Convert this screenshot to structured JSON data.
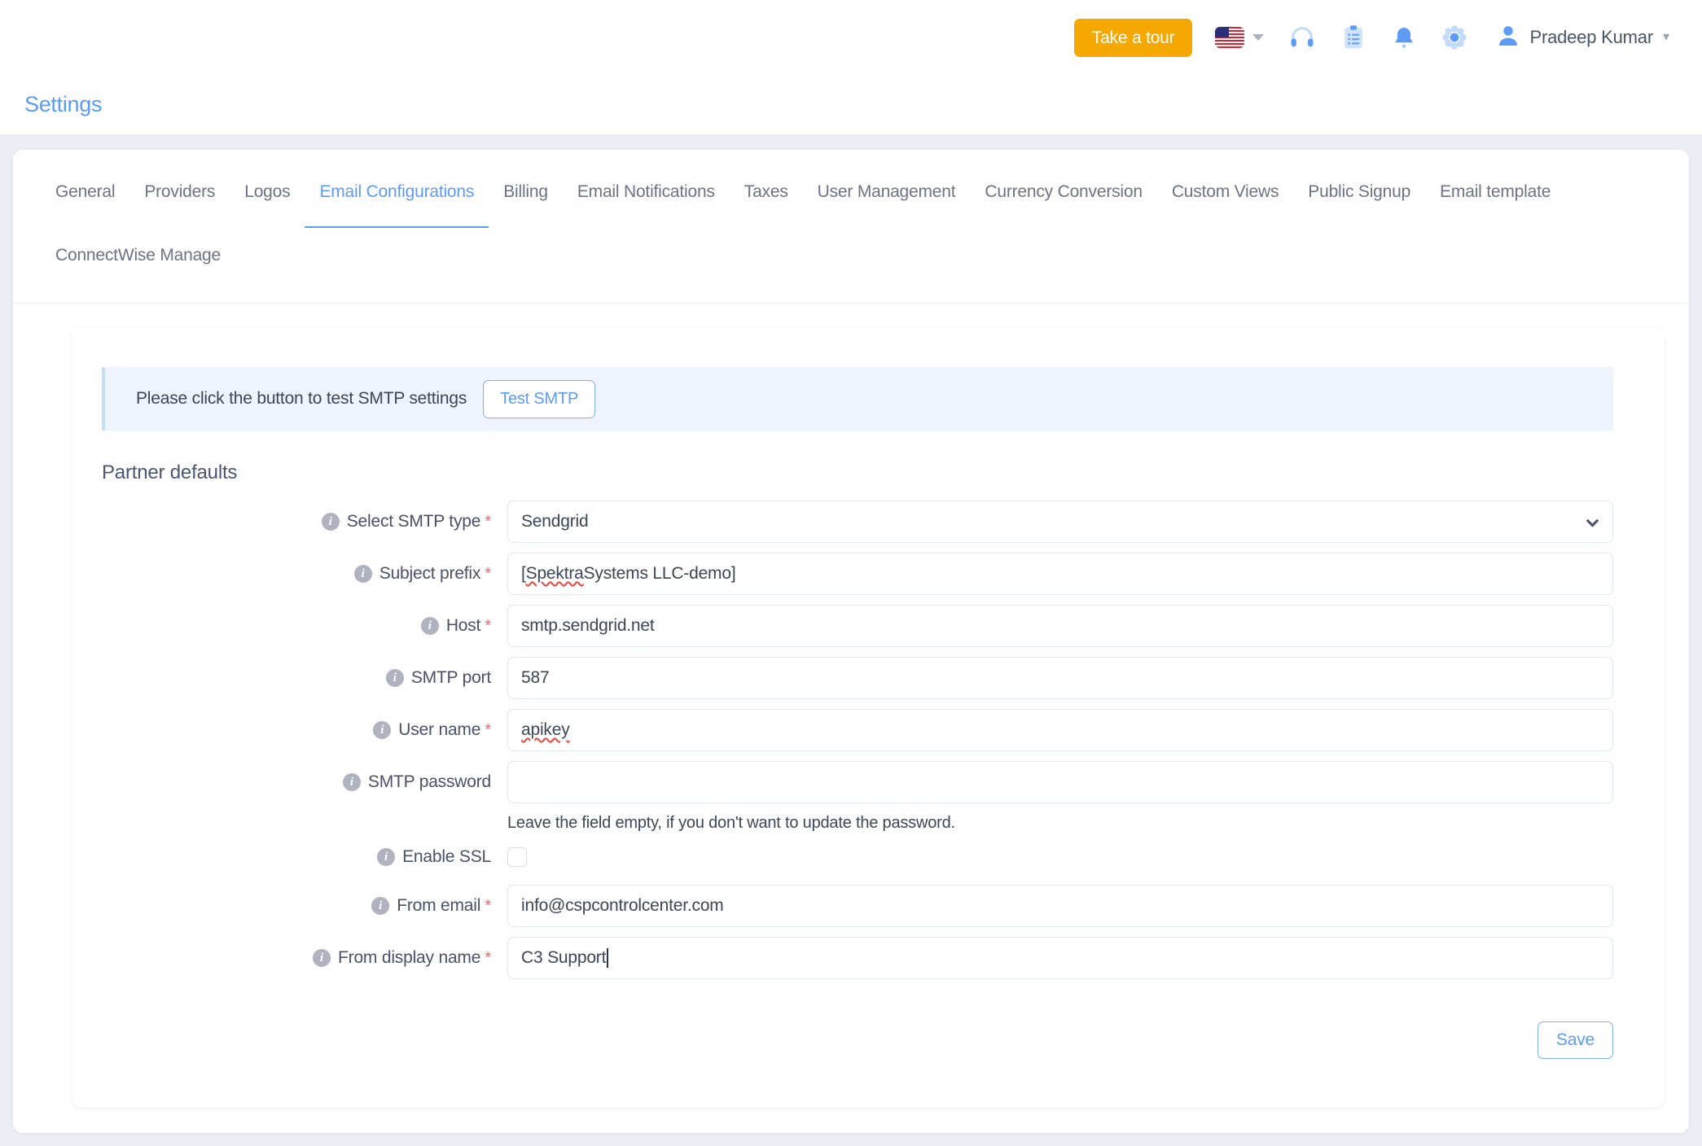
{
  "topbar": {
    "take_tour_label": "Take a tour",
    "flag_icon": "us-flag-icon",
    "language_caret": "chevron-down-icon",
    "support_icon": "headset-icon",
    "tasks_icon": "clipboard-icon",
    "notifications_icon": "bell-icon",
    "settings_icon": "gear-icon",
    "avatar_icon": "user-avatar-icon",
    "user_name": "Pradeep Kumar",
    "user_caret": "chevron-down-icon"
  },
  "page": {
    "title": "Settings"
  },
  "tabs": {
    "active": "Email Configurations",
    "row1": [
      {
        "label": "General"
      },
      {
        "label": "Providers"
      },
      {
        "label": "Logos"
      },
      {
        "label": "Email Configurations"
      },
      {
        "label": "Billing"
      },
      {
        "label": "Email Notifications"
      },
      {
        "label": "Taxes"
      },
      {
        "label": "User Management"
      },
      {
        "label": "Currency Conversion"
      },
      {
        "label": "Custom Views"
      },
      {
        "label": "Public Signup"
      },
      {
        "label": "Email template"
      }
    ],
    "row2": [
      {
        "label": "ConnectWise Manage"
      }
    ]
  },
  "alert": {
    "text": "Please click the button to test SMTP settings",
    "button_label": "Test SMTP"
  },
  "form": {
    "heading": "Partner defaults",
    "fields": {
      "smtp_type": {
        "label": "Select SMTP type",
        "required": "*",
        "value": "Sendgrid",
        "options": [
          "Sendgrid"
        ]
      },
      "subject_prefix": {
        "label": "Subject prefix",
        "required": "*",
        "value": "[Spektra Systems LLC-demo]",
        "value_prefix": "[",
        "value_spell": "Spektra",
        "value_suffix": " Systems LLC-demo]"
      },
      "host": {
        "label": "Host",
        "required": "*",
        "value": "smtp.sendgrid.net"
      },
      "smtp_port": {
        "label": "SMTP port",
        "required": "",
        "value": "587"
      },
      "user_name": {
        "label": "User name",
        "required": "*",
        "value": "apikey"
      },
      "smtp_password": {
        "label": "SMTP password",
        "required": "",
        "value": "",
        "note": "Leave the field empty, if you don't want to update the password."
      },
      "enable_ssl": {
        "label": "Enable SSL",
        "required": "",
        "checked": false
      },
      "from_email": {
        "label": "From email",
        "required": "*",
        "value": "info@cspcontrolcenter.com"
      },
      "from_display_name": {
        "label": "From display name",
        "required": "*",
        "value": "C3 Support",
        "focused": true
      }
    },
    "save_label": "Save"
  },
  "colors": {
    "accent_blue": "#5d9cf5",
    "tour_orange": "#f5a800",
    "required_red": "#f06a6a",
    "page_bg": "#eceef5",
    "alert_bg": "#eef3fd",
    "alert_border": "#c7dcf5",
    "info_icon_grey": "#b0b3bf"
  }
}
